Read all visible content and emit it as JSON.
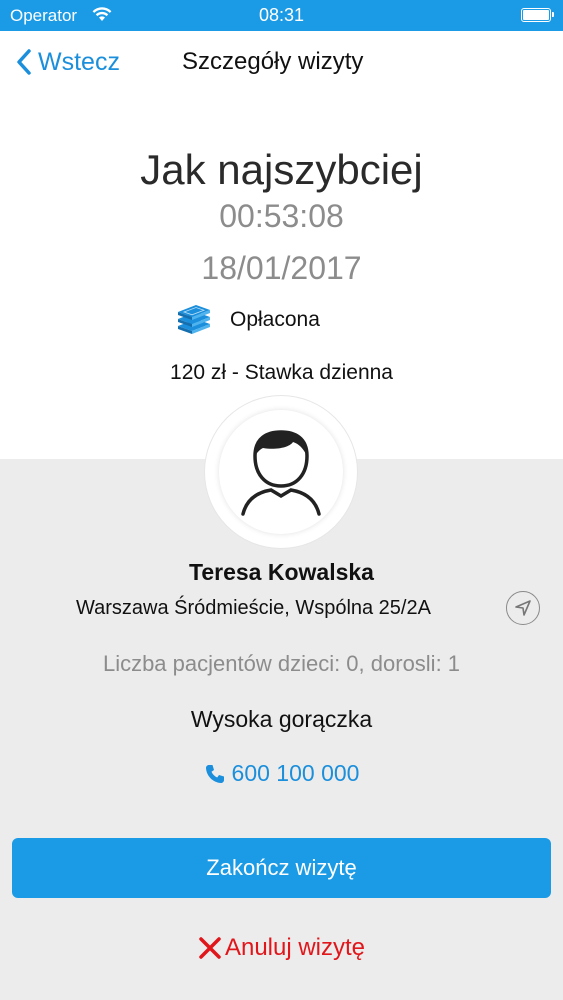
{
  "status_bar": {
    "carrier": "Operator",
    "time": "08:31",
    "wifi_icon": "wifi-icon",
    "battery_icon": "battery-icon"
  },
  "nav": {
    "back_label": "Wstecz",
    "back_icon": "chevron-left-icon",
    "title": "Szczegóły wizyty"
  },
  "visit": {
    "time_label": "Jak najszybciej",
    "timer": "00:53:08",
    "date": "18/01/2017",
    "payment_status": "Opłacona",
    "payment_icon": "money-stack-icon",
    "rate": "120 zł - Stawka dzienna"
  },
  "patient": {
    "avatar_icon": "user-avatar-icon",
    "name": "Teresa Kowalska",
    "address": "Warszawa Śródmieście, Wspólna 25/2A",
    "locate_icon": "navigation-arrow-icon",
    "patients_count": "Liczba pacjentów dzieci: 0, dorosli: 1",
    "symptom": "Wysoka gorączka",
    "phone": "600 100 000",
    "phone_icon": "phone-icon"
  },
  "actions": {
    "finish_label": "Zakończ wizytę",
    "cancel_label": "Anuluj wizytę",
    "cancel_icon": "close-x-icon"
  },
  "colors": {
    "accent": "#1b9be6",
    "link": "#1b8fdc",
    "danger": "#e0161b",
    "muted": "#8c8c8c"
  }
}
